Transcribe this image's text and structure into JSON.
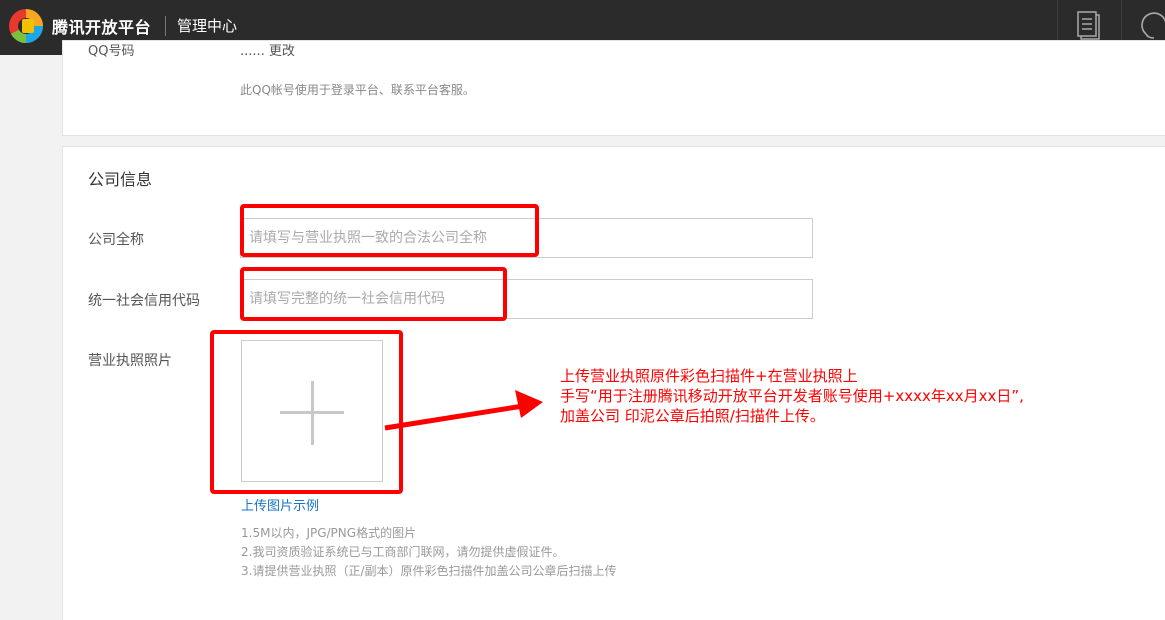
{
  "header": {
    "brand": "腾讯开放平台",
    "center": "管理中心",
    "icons": [
      "tencent-logo-icon",
      "document-icon",
      "headset-icon"
    ]
  },
  "account": {
    "label": "QQ号码",
    "value": "...... 更改",
    "hint": "此QQ帐号使用于登录平台、联系平台客服。"
  },
  "company": {
    "section_title": "公司信息",
    "full_name_label": "公司全称",
    "full_name_placeholder": "请填写与营业执照一致的合法公司全称",
    "credit_code_label": "统一社会信用代码",
    "credit_code_placeholder": "请填写完整的统一社会信用代码",
    "license_photo_label": "营业执照照片",
    "upload_sample_link": "上传图片示例",
    "notes": [
      "1.5M以内，JPG/PNG格式的图片",
      "2.我司资质验证系统已与工商部门联网，请勿提供虚假证件。",
      "3.请提供营业执照（正/副本）原件彩色扫描件加盖公司公章后扫描上传"
    ]
  },
  "annotation": {
    "text": "上传营业执照原件彩色扫描件+在营业执照上\n手写“用于注册腾讯移动开放平台开发者账号使用+xxxx年xx月xx日”,\n加盖公司 印泥公章后拍照/扫描件上传。",
    "color": "#ff0000"
  },
  "colors": {
    "topbar": "#2b2b2b",
    "link": "#1a73c8",
    "annotation_red": "#ff0000"
  }
}
